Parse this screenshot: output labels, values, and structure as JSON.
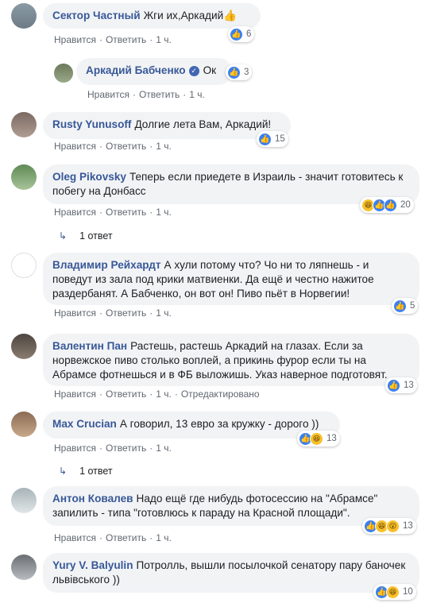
{
  "actions": {
    "like": "Нравится",
    "reply": "Ответить",
    "time": "1 ч.",
    "edited": "Отредактировано",
    "dot": "·"
  },
  "comments": [
    {
      "author": "Сектор Частный",
      "text": "Жги их,Аркадий👍",
      "reactions": [
        "like"
      ],
      "count": "6"
    },
    {
      "author": "Аркадий Бабченко",
      "text": "Ок",
      "reactions": [
        "like"
      ],
      "count": "3",
      "verified": true
    },
    {
      "author": "Rusty Yunusoff",
      "text": "Долгие лета Вам, Аркадий!",
      "reactions": [
        "like"
      ],
      "count": "15"
    },
    {
      "author": "Oleg Pikovsky",
      "text": "Теперь если приедете в Израиль - значит готовитесь к побегу на Донбасс",
      "reactions": [
        "haha",
        "like",
        "like"
      ],
      "count": "20",
      "replies": "1 ответ"
    },
    {
      "author": "Владимир Рейхардт",
      "text": "А хули потому что? Чо ни то ляпнешь - и поведут из зала под крики матвиенки. Да ещё и честно нажитое раздербанят. А Бабченко, он вот он! Пиво пьёт в Норвегии!",
      "reactions": [
        "like"
      ],
      "count": "5"
    },
    {
      "author": "Валентин Пан",
      "text": "Растешь, растешь Аркадий на глазах. Если за норвежское пиво столько воплей, а прикинь фурор если ты на Абрамсе фотнешься и в ФБ выложишь. Указ наверное подготовят.",
      "reactions": [
        "like"
      ],
      "count": "13",
      "edited": true
    },
    {
      "author": "Max Crucian",
      "text": "А говорил, 13 евро за кружку - дорого ))",
      "reactions": [
        "like",
        "haha"
      ],
      "count": "13",
      "replies": "1 ответ"
    },
    {
      "author": "Антон Ковалев",
      "text": "Надо ещё где нибудь фотосессию на \"Абрамсе\" запилить - типа \"готовлюсь к параду на Красной площади\".",
      "reactions": [
        "like",
        "haha",
        "haha"
      ],
      "count": "13"
    },
    {
      "author": "Yury V. Balyulin",
      "text": "Потролль, вышли посылочкой сенатору пару баночек львівського ))",
      "reactions": [
        "like",
        "haha"
      ],
      "count": "10"
    }
  ]
}
